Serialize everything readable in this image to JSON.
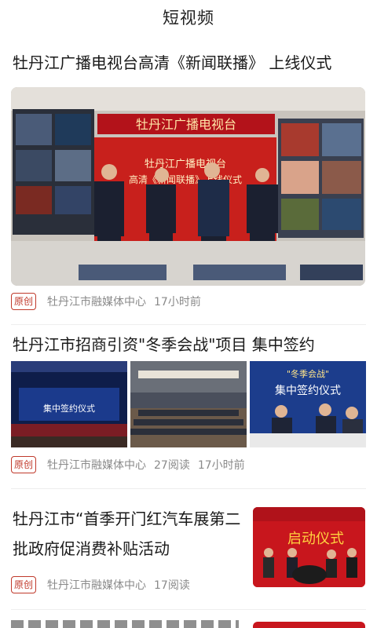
{
  "header": {
    "title": "短视频"
  },
  "articles": [
    {
      "title": "牡丹江广播电视台高清《新闻联播》 上线仪式",
      "badge": "原创",
      "source": "牡丹江市融媒体中心",
      "time": "17小时前",
      "image_text": {
        "banner": "牡丹江广播电视台",
        "screen_line1": "牡丹江广播电视台",
        "screen_line2": "高清《新闻联播》上线仪式"
      }
    },
    {
      "title": "牡丹江市招商引资\"冬季会战\"项目 集中签约",
      "badge": "原创",
      "source": "牡丹江市融媒体中心",
      "reads": "27阅读",
      "time": "17小时前",
      "image_text": {
        "thumb1": "集中签约仪式",
        "thumb3_line1": "\"冬季会战\"",
        "thumb3_line2": "集中签约仪式"
      }
    },
    {
      "title": "牡丹江市“首季开门红汽车展第二批政府促消费补贴活动",
      "badge": "原创",
      "source": "牡丹江市融媒体中心",
      "reads": "17阅读",
      "image_text": {
        "banner": "启动仪式"
      }
    }
  ],
  "colors": {
    "accent": "#c0392b",
    "meta": "#8a8a8a"
  }
}
